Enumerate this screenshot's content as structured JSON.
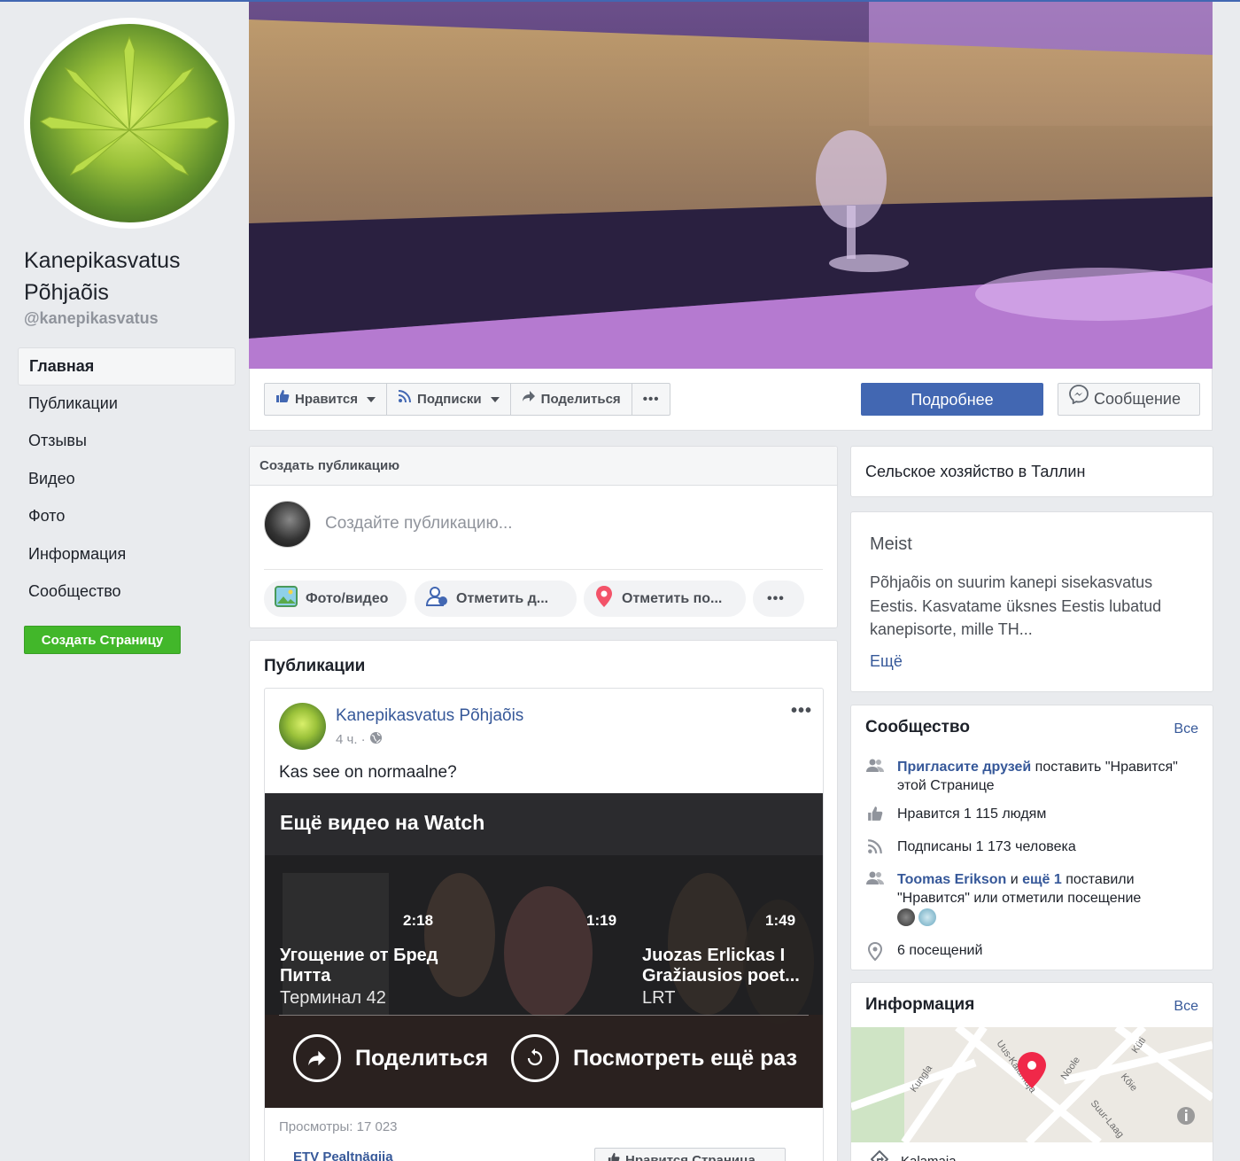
{
  "page": {
    "name": "Kanepikasvatus Põhjaõis",
    "handle": "@kanepikasvatus"
  },
  "nav": {
    "items": [
      {
        "label": "Главная"
      },
      {
        "label": "Публикации"
      },
      {
        "label": "Отзывы"
      },
      {
        "label": "Видео"
      },
      {
        "label": "Фото"
      },
      {
        "label": "Информация"
      },
      {
        "label": "Сообщество"
      }
    ],
    "create_page": "Создать Страницу"
  },
  "actions": {
    "like": "Нравится",
    "follow": "Подписки",
    "share": "Поделиться",
    "more": "•••",
    "details": "Подробнее",
    "message": "Сообщение"
  },
  "composer": {
    "title": "Создать публикацию",
    "placeholder": "Создайте публикацию...",
    "photo_video": "Фото/видео",
    "tag_friends": "Отметить д...",
    "check_in": "Отметить по...",
    "more": "•••"
  },
  "posts": {
    "title": "Публикации",
    "post": {
      "author": "Kanepikasvatus Põhjaõis",
      "time": "4 ч. ·",
      "text": "Kas see on normaalne?",
      "more": "•••",
      "video": {
        "heading": "Ещё видео на Watch",
        "items": [
          {
            "duration": "2:18",
            "title": "Угощение от Бред Питта",
            "source": "Терминал 42"
          },
          {
            "duration": "1:19"
          },
          {
            "duration": "1:49",
            "title": "Juozas Erlickas I Gražiausios poet...",
            "source": "LRT"
          }
        ],
        "share": "Поделиться",
        "replay": "Посмотреть ещё раз"
      },
      "views": "Просмотры: 17 023",
      "link": "ETV Pealtnägija",
      "like_page": "Нравится Страница"
    }
  },
  "right": {
    "category": "Сельское хозяйство в Таллин",
    "about": {
      "title": "Meist",
      "text": "Põhjaõis on suurim kanepi sisekasvatus Eestis. Kasvatame üksnes Eestis lubatud kanepisorte, mille TH...",
      "more": "Ещё"
    },
    "community": {
      "title": "Сообщество",
      "all": "Все",
      "invite_link": "Пригласите друзей",
      "invite_rest": " поставить \"Нравится\" этой Странице",
      "likes": "Нравится 1 115 людям",
      "follows": "Подписаны 1 173 человека",
      "friend_name": "Toomas Erikson",
      "friend_and": " и ",
      "friend_more": "ещё 1",
      "friend_rest": " поставили \"Нравится\" или отметили посещение",
      "visits": "6 посещений"
    },
    "info": {
      "title": "Информация",
      "all": "Все",
      "streets": [
        "Kungla",
        "Uus-Kalamaja",
        "Noole",
        "Kõie",
        "Küti",
        "Suur-Laag"
      ],
      "address": "Kalamaja"
    }
  },
  "colors": {
    "brand": "#4267b2",
    "link": "#365899",
    "create_page_green": "#42b72a",
    "background": "#e9ebee"
  }
}
